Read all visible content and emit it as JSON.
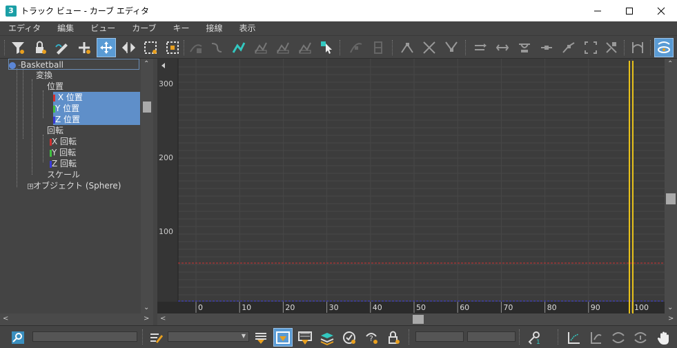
{
  "window": {
    "app_icon": "3",
    "title": "トラック ビュー - カーブ エディタ"
  },
  "menu": [
    "エディタ",
    "編集",
    "ビュー",
    "カーブ",
    "キー",
    "接線",
    "表示"
  ],
  "toolbar_icons": [
    "filter-icon",
    "lock-selection-icon",
    "draw-curves-icon",
    "add-key-icon",
    "move-keys-icon",
    "slide-keys-icon",
    "scale-keys-icon",
    "scale-values-icon",
    "lock-tangents-icon",
    "region-tool-icon",
    "snap-icon",
    "set-keys-icon",
    "isolate-curve-icon",
    "show-tangents-icon",
    "select-icon",
    "tangent-auto-icon",
    "tangent-spline-icon",
    "tangent-fast-icon",
    "tangent-slow-icon",
    "tangent-step-icon",
    "tangent-linear-icon",
    "tangent-smooth-icon",
    "break-tangents-icon",
    "unify-tangents-icon",
    "align-icon",
    "move-icon",
    "scale-icon",
    "normalize-icon",
    "frame-all-icon",
    "zoom-extents-icon",
    "zoom-region-icon",
    "navigate-icon",
    "view-options-icon"
  ],
  "tree": {
    "root": "Basketball",
    "transform": "変換",
    "position": "位置",
    "x_position": "X 位置",
    "y_position": "Y 位置",
    "z_position": "Z 位置",
    "rotation": "回転",
    "x_rotation": "X 回転",
    "y_rotation": "Y 回転",
    "z_rotation": "Z 回転",
    "scale": "スケール",
    "object": "オブジェクト (Sphere)"
  },
  "graph": {
    "y_ticks": [
      "300",
      "200",
      "100"
    ],
    "x_ticks": [
      "0",
      "10",
      "20",
      "30",
      "40",
      "50",
      "60",
      "70",
      "80",
      "90",
      "100"
    ],
    "current_frame_color": "#e8c21a",
    "x_curve_color": "#d03030",
    "z_curve_color": "#3a3ad8"
  },
  "bottom_icons": [
    "zoom-selected-icon",
    "edit-list-icon",
    "filter-selected-icon",
    "filter-animated-icon",
    "filter-all-icon",
    "layers-icon",
    "show-keyable-icon",
    "show-unlocked-icon",
    "lock-icon",
    "key-stats-icon",
    "graph-axis-icon",
    "pan-icon",
    "zoom-h-icon",
    "zoom-v-icon",
    "hand-icon"
  ]
}
